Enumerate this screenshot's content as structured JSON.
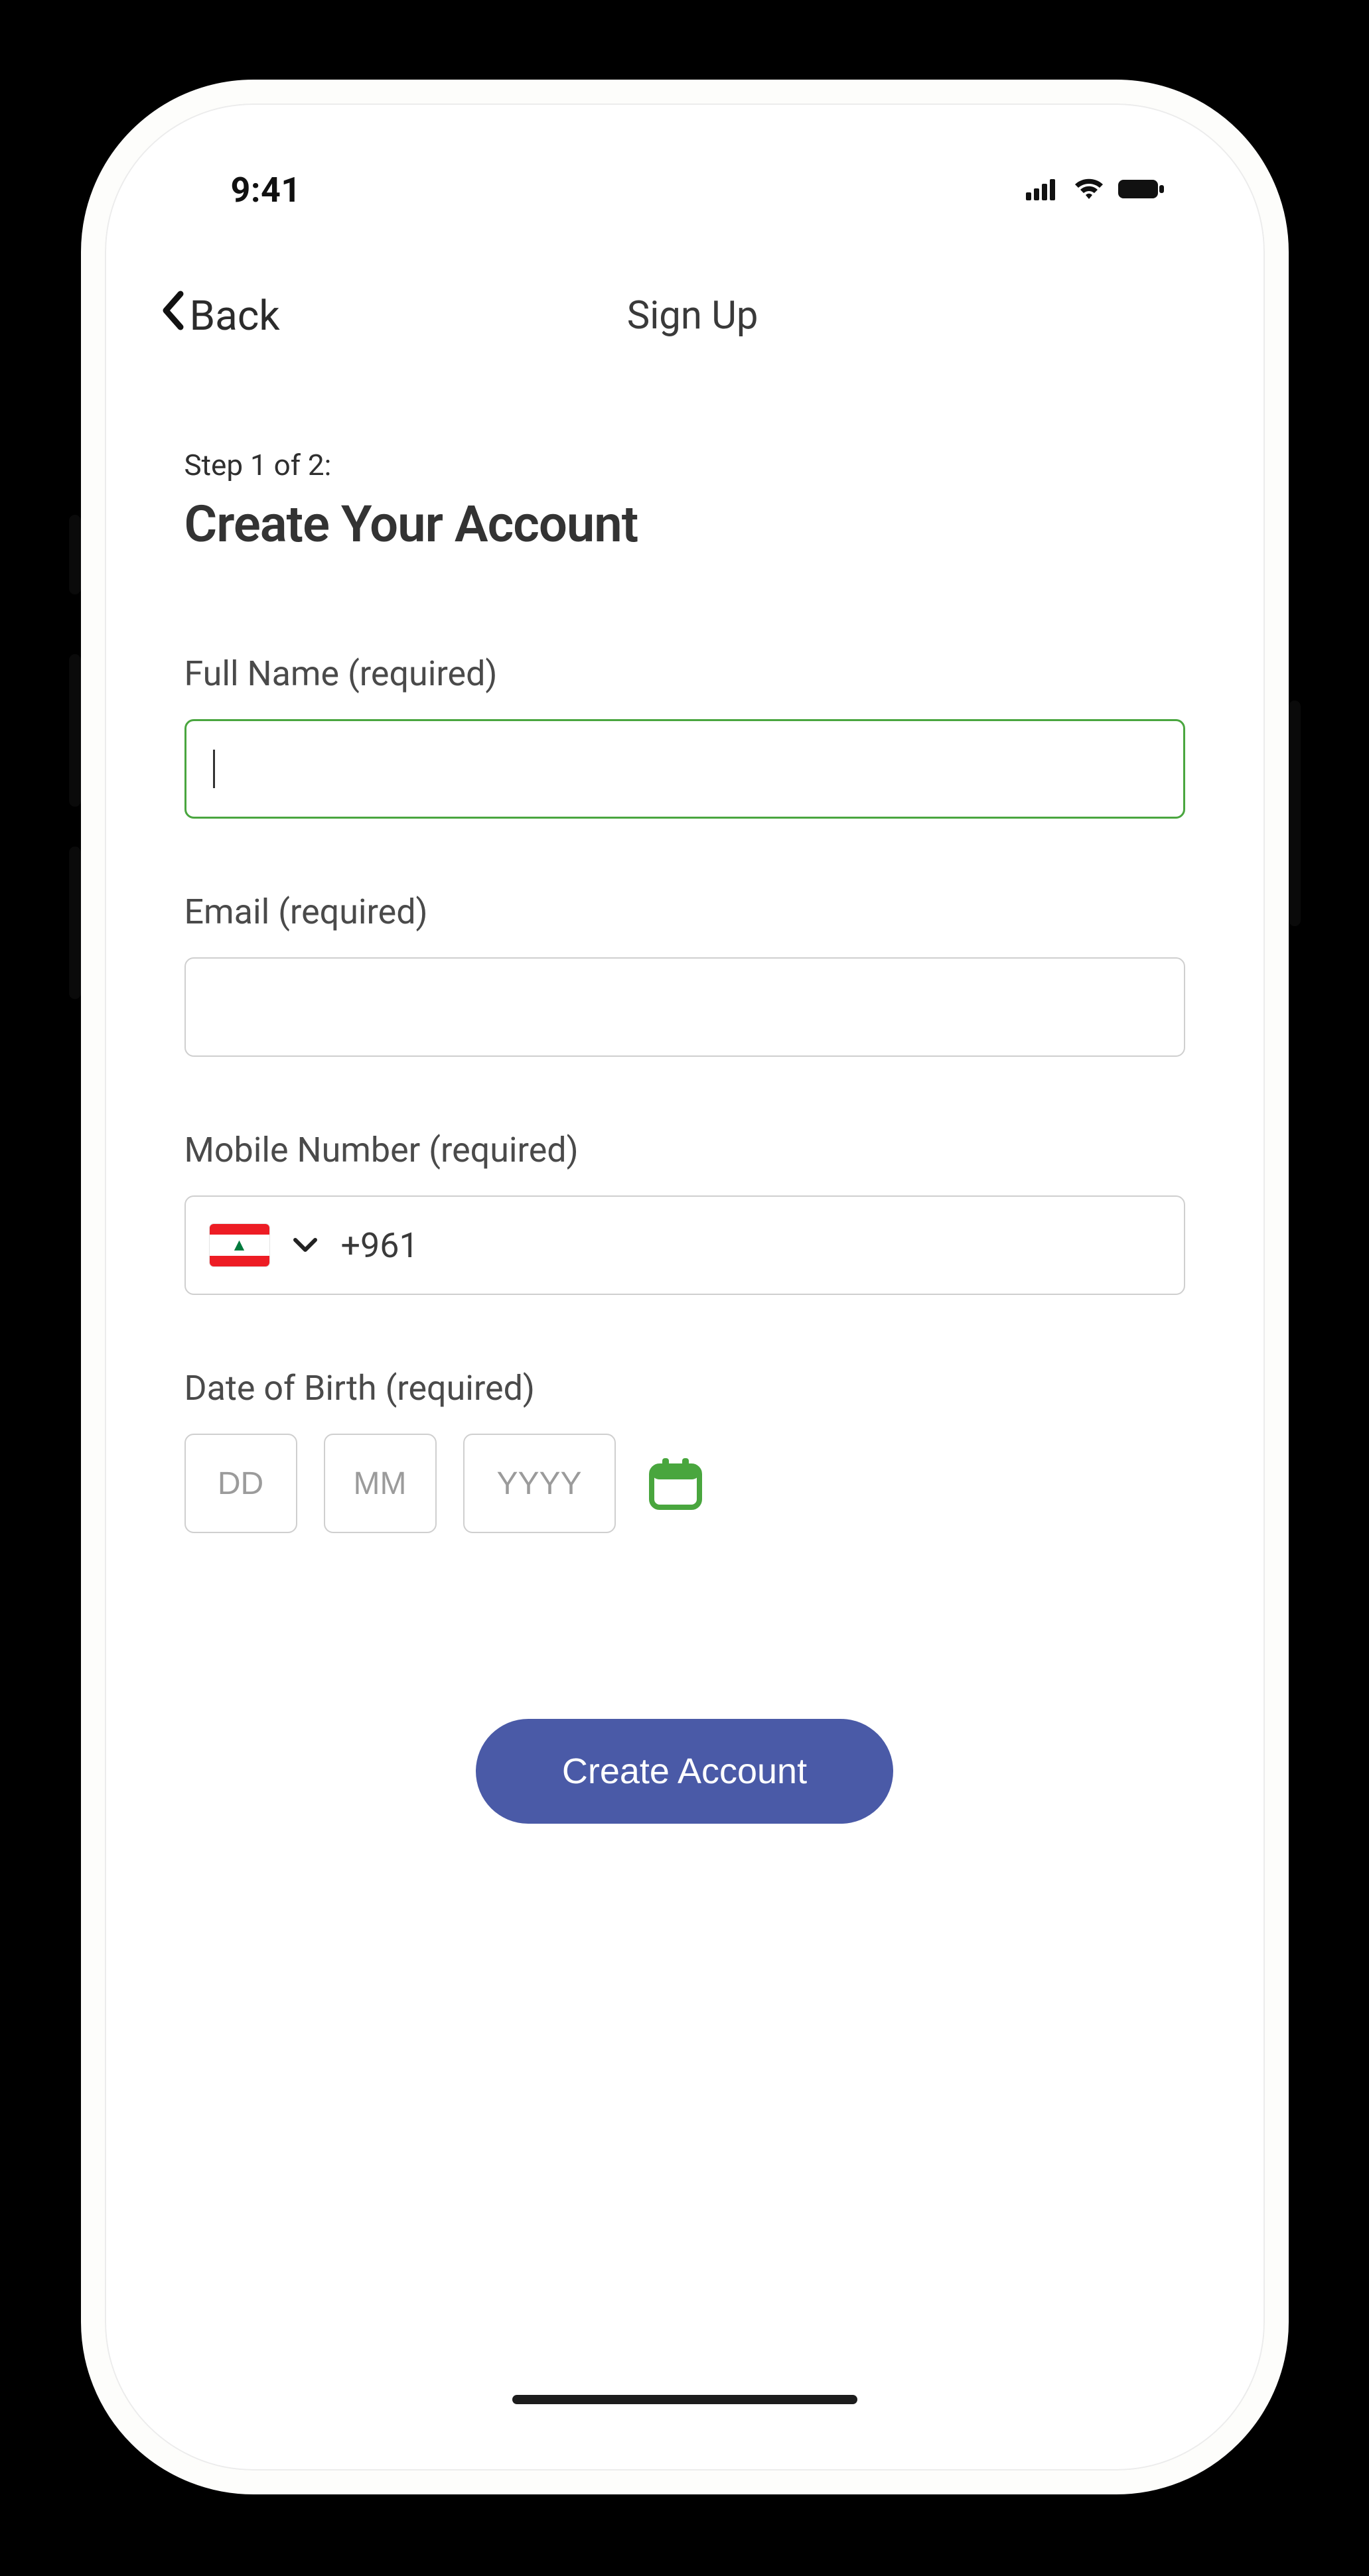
{
  "status": {
    "time": "9:41"
  },
  "nav": {
    "back_label": "Back",
    "title": "Sign Up"
  },
  "header": {
    "step_label": "Step 1 of 2:",
    "heading": "Create Your Account"
  },
  "fields": {
    "full_name": {
      "label": "Full Name (required)",
      "value": ""
    },
    "email": {
      "label": "Email (required)",
      "value": ""
    },
    "mobile": {
      "label": "Mobile Number (required)",
      "dial_code": "+961",
      "country": "Lebanon"
    },
    "dob": {
      "label": "Date of Birth (required)",
      "dd_placeholder": "DD",
      "mm_placeholder": "MM",
      "yyyy_placeholder": "YYYY"
    }
  },
  "cta": {
    "label": "Create Account"
  },
  "colors": {
    "accent_green": "#4aa63f",
    "primary_button": "#4a5aa7",
    "border_gray": "#cfcfcf"
  }
}
